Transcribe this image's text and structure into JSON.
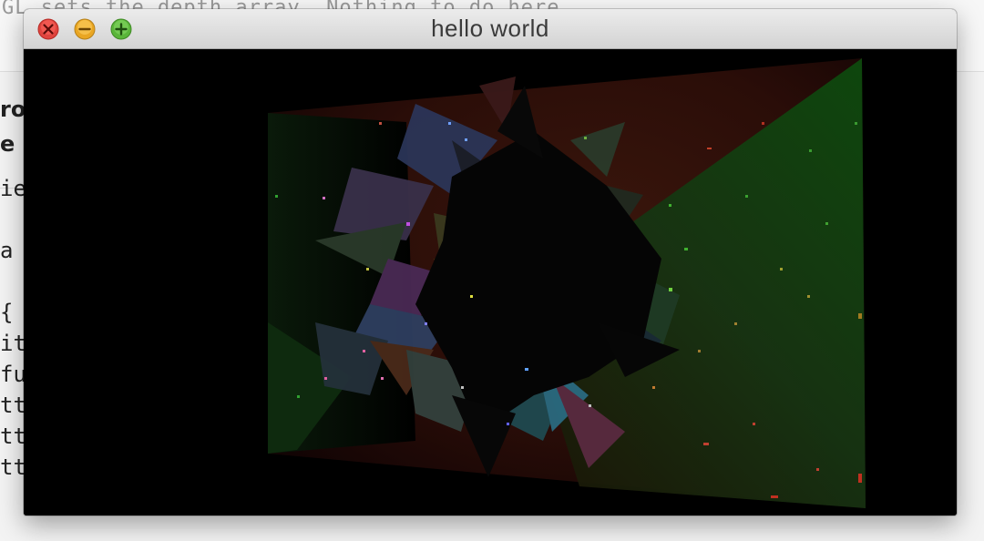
{
  "window": {
    "title": "hello world"
  },
  "background_document": {
    "top_line": "GL sets the depth array. Nothing to do here.",
    "heading_lines": [
      "ro",
      "e"
    ],
    "code_lines": [
      "ie",
      "",
      " a",
      "",
      " {",
      "it",
      "fu",
      "tt",
      "tt",
      "tt"
    ]
  },
  "colors": {
    "close": "#ff5f57",
    "minimize": "#febc2e",
    "maximize": "#28c840",
    "canvas": "#000000"
  },
  "icons": {
    "close": "close-x-icon",
    "minimize": "minimize-minus-icon",
    "maximize": "maximize-plus-icon"
  }
}
